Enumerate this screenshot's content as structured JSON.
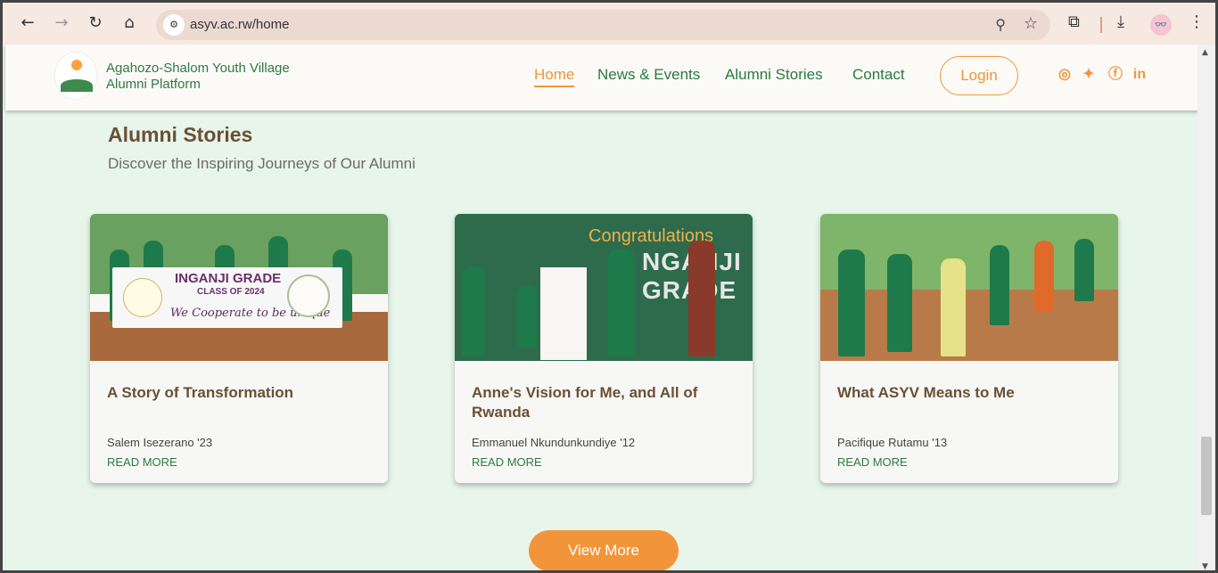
{
  "browser": {
    "url": "asyv.ac.rw/home",
    "icons": [
      "back-icon",
      "forward-icon",
      "reload-icon",
      "home-icon",
      "site-info-icon",
      "zoom-icon",
      "star-icon",
      "extensions-icon",
      "download-icon",
      "profile-avatar",
      "menu-icon"
    ]
  },
  "header": {
    "brand_line1": "Agahozo-Shalom Youth Village",
    "brand_line2": "Alumni Platform",
    "nav": [
      "Home",
      "News & Events",
      "Alumni Stories",
      "Contact"
    ],
    "login": "Login",
    "social": [
      "instagram-icon",
      "twitter-icon",
      "facebook-icon",
      "linkedin-icon"
    ]
  },
  "section": {
    "title": "Alumni Stories",
    "subtitle": "Discover the Inspiring Journeys of Our Alumni"
  },
  "cards": [
    {
      "title": "A Story of Transformation",
      "author": "Salem Isezerano '23",
      "read_more": "READ MORE",
      "banner_title": "INGANJI GRADE",
      "banner_class": "CLASS OF 2024",
      "banner_motto": "We Cooperate to be unique"
    },
    {
      "title": "Anne's Vision for Me, and All of Rwanda",
      "author": "Emmanuel Nkundunkundiye '12",
      "read_more": "READ MORE",
      "backdrop_text": "Congratulations",
      "backdrop_grade": "NGANJI GRADE"
    },
    {
      "title": "What ASYV Means to Me",
      "author": "Pacifique Rutamu '13",
      "read_more": "READ MORE"
    }
  ],
  "view_more": "View More",
  "colors": {
    "accent": "#f2953a",
    "brand_green": "#2f7a45",
    "heading_brown": "#6a5034",
    "section_bg": "#e7f5ea"
  }
}
